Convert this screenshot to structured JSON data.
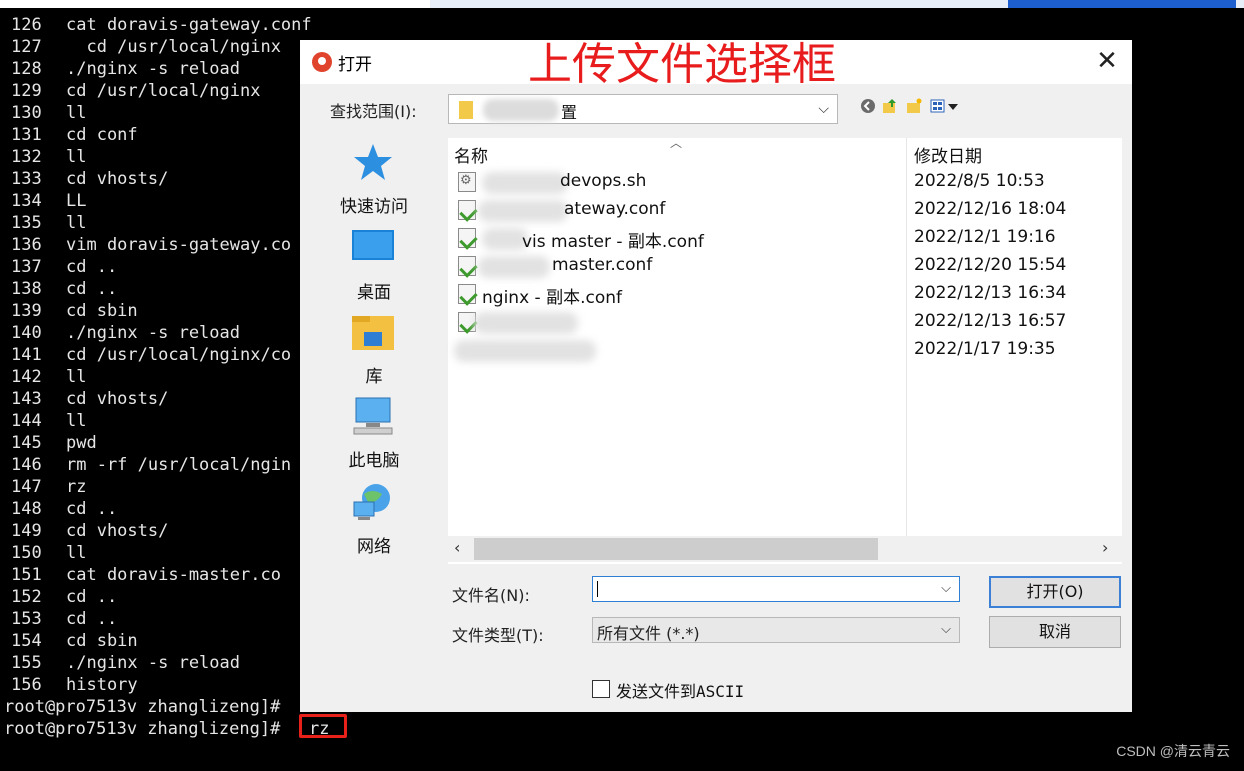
{
  "terminal": {
    "lines": [
      {
        "num": "126",
        "cmd": "cat doravis-gateway.conf"
      },
      {
        "num": "127",
        "cmd": "  cd /usr/local/nginx"
      },
      {
        "num": "128",
        "cmd": "./nginx -s reload"
      },
      {
        "num": "129",
        "cmd": "cd /usr/local/nginx"
      },
      {
        "num": "130",
        "cmd": "ll"
      },
      {
        "num": "131",
        "cmd": "cd conf"
      },
      {
        "num": "132",
        "cmd": "ll"
      },
      {
        "num": "133",
        "cmd": "cd vhosts/"
      },
      {
        "num": "134",
        "cmd": "LL"
      },
      {
        "num": "135",
        "cmd": "ll"
      },
      {
        "num": "136",
        "cmd": "vim doravis-gateway.co"
      },
      {
        "num": "137",
        "cmd": "cd .."
      },
      {
        "num": "138",
        "cmd": "cd .."
      },
      {
        "num": "139",
        "cmd": "cd sbin"
      },
      {
        "num": "140",
        "cmd": "./nginx -s reload"
      },
      {
        "num": "141",
        "cmd": "cd /usr/local/nginx/co"
      },
      {
        "num": "142",
        "cmd": "ll"
      },
      {
        "num": "143",
        "cmd": "cd vhosts/"
      },
      {
        "num": "144",
        "cmd": "ll"
      },
      {
        "num": "145",
        "cmd": "pwd"
      },
      {
        "num": "146",
        "cmd": "rm -rf /usr/local/ngin"
      },
      {
        "num": "147",
        "cmd": "rz"
      },
      {
        "num": "148",
        "cmd": "cd .."
      },
      {
        "num": "149",
        "cmd": "cd vhosts/"
      },
      {
        "num": "150",
        "cmd": "ll"
      },
      {
        "num": "151",
        "cmd": "cat doravis-master.co"
      },
      {
        "num": "152",
        "cmd": "cd .."
      },
      {
        "num": "153",
        "cmd": "cd .."
      },
      {
        "num": "154",
        "cmd": "cd sbin"
      },
      {
        "num": "155",
        "cmd": "./nginx -s reload"
      },
      {
        "num": "156",
        "cmd": "history"
      }
    ],
    "prompt1": "root@pro7513v zhanglizeng]#",
    "prompt2": "root@pro7513v zhanglizeng]#",
    "typed_command": "rz"
  },
  "dialog": {
    "title": "打开",
    "annotation": "上传文件选择框",
    "close_glyph": "✕",
    "lookin_label": "查找范围(I):",
    "lookin_value": "置",
    "places": [
      {
        "label": "快速访问",
        "icon": "quick-access-icon"
      },
      {
        "label": "桌面",
        "icon": "desktop-icon"
      },
      {
        "label": "库",
        "icon": "library-icon"
      },
      {
        "label": "此电脑",
        "icon": "this-pc-icon"
      },
      {
        "label": "网络",
        "icon": "network-icon"
      }
    ],
    "columns": {
      "name": "名称",
      "date": "修改日期"
    },
    "files": [
      {
        "name": "devops.sh",
        "date": "2022/8/5 10:53",
        "type": "sh"
      },
      {
        "name": "ateway.conf",
        "date": "2022/12/16 18:04",
        "type": "conf"
      },
      {
        "name": "vis master - 副本.conf",
        "date": "2022/12/1 19:16",
        "type": "conf"
      },
      {
        "name": "master.conf",
        "date": "2022/12/20 15:54",
        "type": "conf"
      },
      {
        "name": "nginx - 副本.conf",
        "date": "2022/12/13 16:34",
        "type": "conf"
      },
      {
        "name": "",
        "date": "2022/12/13 16:57",
        "type": "conf"
      },
      {
        "name": "",
        "date": "2022/1/17 19:35",
        "type": "file"
      }
    ],
    "filename_label": "文件名(N):",
    "filename_value": "",
    "filetype_label": "文件类型(T):",
    "filetype_value": "所有文件 (*.*)",
    "open_button": "打开(O)",
    "cancel_button": "取消",
    "ascii_checkbox_label": "发送文件到ASCII"
  },
  "watermark": "CSDN @清云青云",
  "colors": {
    "annotation_red": "#e81c1c",
    "accent_blue": "#3b7fd6"
  }
}
